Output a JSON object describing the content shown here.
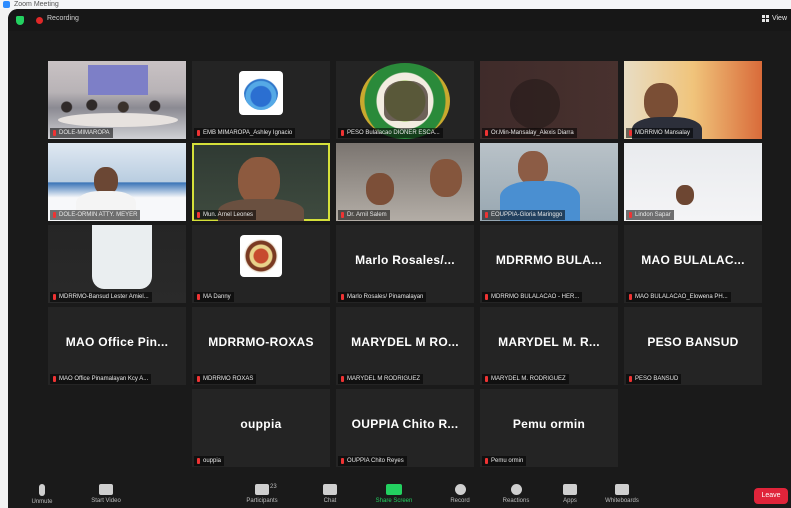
{
  "window": {
    "title": "Zoom Meeting"
  },
  "status": {
    "recording_label": "Recording",
    "view_label": "View"
  },
  "colors": {
    "speaking_outline": "#d5e03a",
    "share_green": "#23d160",
    "leave_red": "#e0243a",
    "muted_red": "#e33333"
  },
  "tiles": [
    {
      "label": "DOLE-MIMAROPA",
      "big": ""
    },
    {
      "label": "EMB MIMAROPA_Ashley Ignacio",
      "big": ""
    },
    {
      "label": "PESO Bulalacao DIONER ESCA...",
      "big": ""
    },
    {
      "label": "Or.Min-Mansalay_Alexis Diarra",
      "big": ""
    },
    {
      "label": "MDRRMO Mansalay",
      "big": ""
    },
    {
      "label": "DOLE-ORMIN ATTY. MEYER",
      "big": ""
    },
    {
      "label": "Mun. Arnel Leones",
      "big": ""
    },
    {
      "label": "Dr. Arnil Salem",
      "big": ""
    },
    {
      "label": "EOUPPIA-Gloria Maringgo",
      "big": ""
    },
    {
      "label": "Lindon Sapar",
      "big": ""
    },
    {
      "label": "MDRRMO-Bansud Lester Amiel...",
      "big": ""
    },
    {
      "label": "MA Danny",
      "big": ""
    },
    {
      "label": "Marlo Rosales/ Pinamalayan",
      "big": "Marlo Rosales/..."
    },
    {
      "label": "MDRRMO BULALACAO - HER...",
      "big": "MDRRMO BULA..."
    },
    {
      "label": "MAO BULALACAO_Elowena PH...",
      "big": "MAO BULALAC..."
    },
    {
      "label": "MAO Office Pinamalayan Kcy A...",
      "big": "MAO Office Pin..."
    },
    {
      "label": "MDRRMO ROXAS",
      "big": "MDRRMO-ROXAS"
    },
    {
      "label": "MARYDEL M RODRIGUEZ",
      "big": "MARYDEL M RO..."
    },
    {
      "label": "MARYDEL M. RODRIGUEZ",
      "big": "MARYDEL M. R..."
    },
    {
      "label": "PESO BANSUD",
      "big": "PESO BANSUD"
    },
    {
      "label": "ouppia",
      "big": "ouppia"
    },
    {
      "label": "OUPPIA Chito Reyes",
      "big": "OUPPIA Chito R..."
    },
    {
      "label": "Pemu ormin",
      "big": "Pemu ormin"
    }
  ],
  "toolbar": {
    "mute": "Unmute",
    "video": "Start Video",
    "participants": "Participants",
    "participants_count": "23",
    "chat": "Chat",
    "share": "Share Screen",
    "record": "Record",
    "reactions": "Reactions",
    "apps": "Apps",
    "whiteboards": "Whiteboards",
    "leave": "Leave"
  }
}
